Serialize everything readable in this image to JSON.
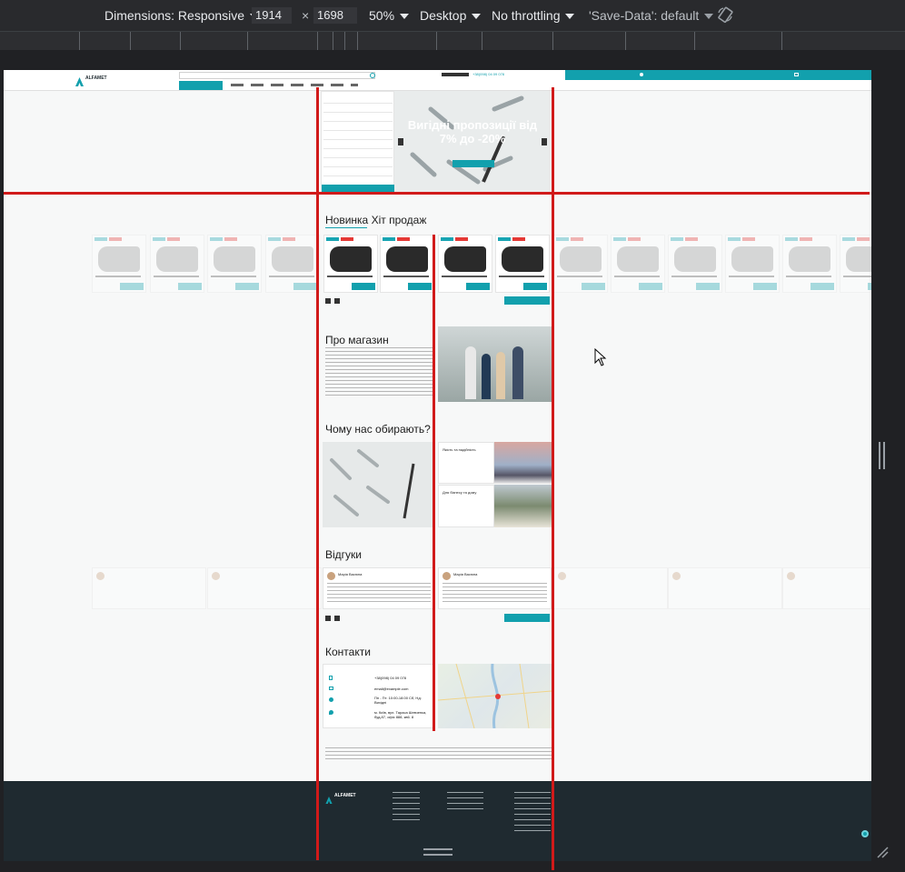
{
  "toolbar": {
    "dimensions_label": "Dimensions: Responsive",
    "width": "1914",
    "times": "×",
    "height": "1698",
    "zoom": "50%",
    "device": "Desktop",
    "throttling": "No throttling",
    "save_data": "'Save-Data': default"
  },
  "site": {
    "logo": "ALFAMET",
    "hero_title": "Вигідні пропозиції від 7% до -20%",
    "sections": {
      "products": "Новинка  Хіт продаж",
      "about": "Про магазин",
      "why": "Чому нас обирають?",
      "reviews": "Відгуки",
      "contacts": "Контакти"
    },
    "product": {
      "badge_new": "новинка",
      "badge_hit": "хіт продаж"
    },
    "why_cards": [
      {
        "title": "Якість та надійність"
      },
      {
        "title": "Для бізнесу та дому"
      }
    ],
    "reviewer": "Марія Васюна",
    "contacts": {
      "phone": "+38(098) 04 09 078",
      "email": "email@example.com",
      "hours": "Пн - Пт: 10:00-18:00 Сб, Нд: Вихідні",
      "address": "м. Київ, вул. Тараса Шевченка, буд.87, офіс 888, кв6. 8"
    }
  },
  "colors": {
    "accent": "#12a0ad",
    "hit": "#e53935",
    "footer": "#1f2a30",
    "guide": "#d11a1a"
  }
}
